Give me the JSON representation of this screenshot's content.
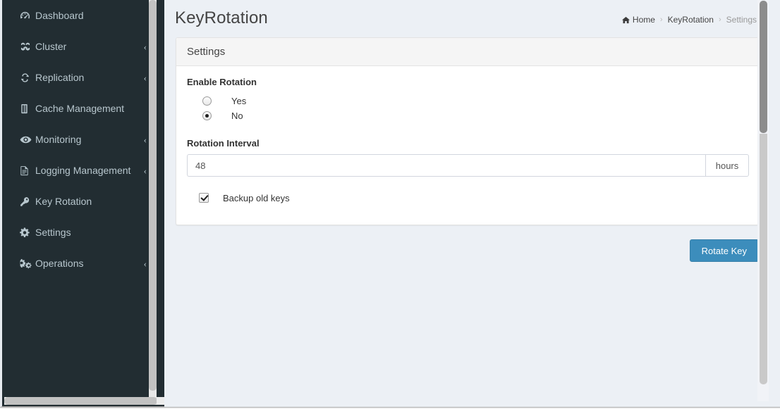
{
  "sidebar": {
    "items": [
      {
        "label": "Dashboard",
        "icon": "dashboard-icon",
        "caret": "",
        "active": false
      },
      {
        "label": "Cluster",
        "icon": "cubes-icon",
        "caret": "‹",
        "active": false
      },
      {
        "label": "Replication",
        "icon": "sync-icon",
        "caret": "‹",
        "active": false
      },
      {
        "label": "Cache Management",
        "icon": "memory-chip-icon",
        "caret": "",
        "active": false
      },
      {
        "label": "Monitoring",
        "icon": "eye-icon",
        "caret": "‹",
        "active": false
      },
      {
        "label": "Logging Management",
        "icon": "file-document-icon",
        "caret": "‹",
        "active": false
      },
      {
        "label": "Key Rotation",
        "icon": "key-icon",
        "caret": "",
        "active": false
      },
      {
        "label": "Settings",
        "icon": "gear-icon",
        "caret": "",
        "active": false
      },
      {
        "label": "Operations",
        "icon": "cogs-icon",
        "caret": "‹",
        "active": false
      }
    ]
  },
  "header": {
    "title": "KeyRotation",
    "breadcrumb": {
      "home": "Home",
      "home_icon": "home-icon",
      "separator": "›",
      "section": "KeyRotation",
      "active": "Settings"
    }
  },
  "panel": {
    "title": "Settings",
    "enable_rotation": {
      "label": "Enable Rotation",
      "options": [
        {
          "label": "Yes",
          "value": "yes",
          "selected": false
        },
        {
          "label": "No",
          "value": "no",
          "selected": true
        }
      ]
    },
    "rotation_interval": {
      "label": "Rotation Interval",
      "value": "48",
      "placeholder": "",
      "unit": "hours"
    },
    "backup_old_keys": {
      "label": "Backup old keys",
      "checked": true
    }
  },
  "actions": {
    "rotate_key": "Rotate Key"
  },
  "colors": {
    "sidebar_bg": "#222d32",
    "sidebar_text": "#b8c7ce",
    "content_bg": "#ecf0f5",
    "panel_bg": "#ffffff",
    "panel_head_bg": "#f5f5f5",
    "accent": "#3c8dbc",
    "link": "#3c8dbc",
    "text": "#444444",
    "muted": "#999999"
  }
}
